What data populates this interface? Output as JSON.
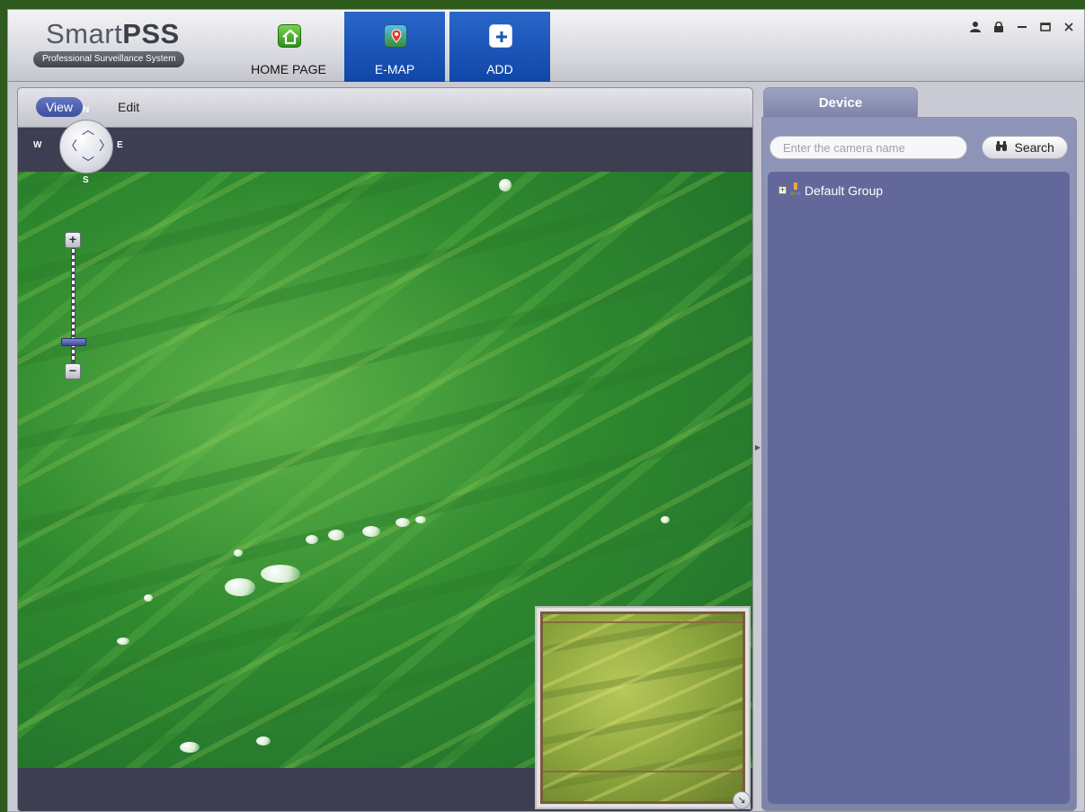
{
  "brand": {
    "name_light": "Smart",
    "name_bold": "PSS",
    "subtitle": "Professional Surveillance System"
  },
  "nav_tabs": [
    {
      "label": "HOME PAGE",
      "icon": "home-icon",
      "active": false
    },
    {
      "label": "E-MAP",
      "icon": "map-pin-icon",
      "active": true
    },
    {
      "label": "ADD",
      "icon": "plus-icon",
      "active": true
    }
  ],
  "window_controls": {
    "user": "user-icon",
    "lock": "lock-icon",
    "minimize": "minimize-icon",
    "maximize": "maximize-icon",
    "close": "close-icon"
  },
  "map": {
    "modes": {
      "view": "View",
      "edit": "Edit"
    },
    "active_mode": "View",
    "compass": {
      "n": "N",
      "s": "S",
      "w": "W",
      "e": "E"
    },
    "zoom": {
      "in": "+",
      "out": "−"
    }
  },
  "device_panel": {
    "tab_label": "Device",
    "search_placeholder": "Enter the camera name",
    "search_button": "Search",
    "tree": [
      {
        "label": "Default Group",
        "expand": "+"
      }
    ]
  },
  "colors": {
    "active_tab": "#1a56b8",
    "view_button": "#4a5cb0",
    "panel": "#7d84aa",
    "tree_background": "#62699a"
  }
}
